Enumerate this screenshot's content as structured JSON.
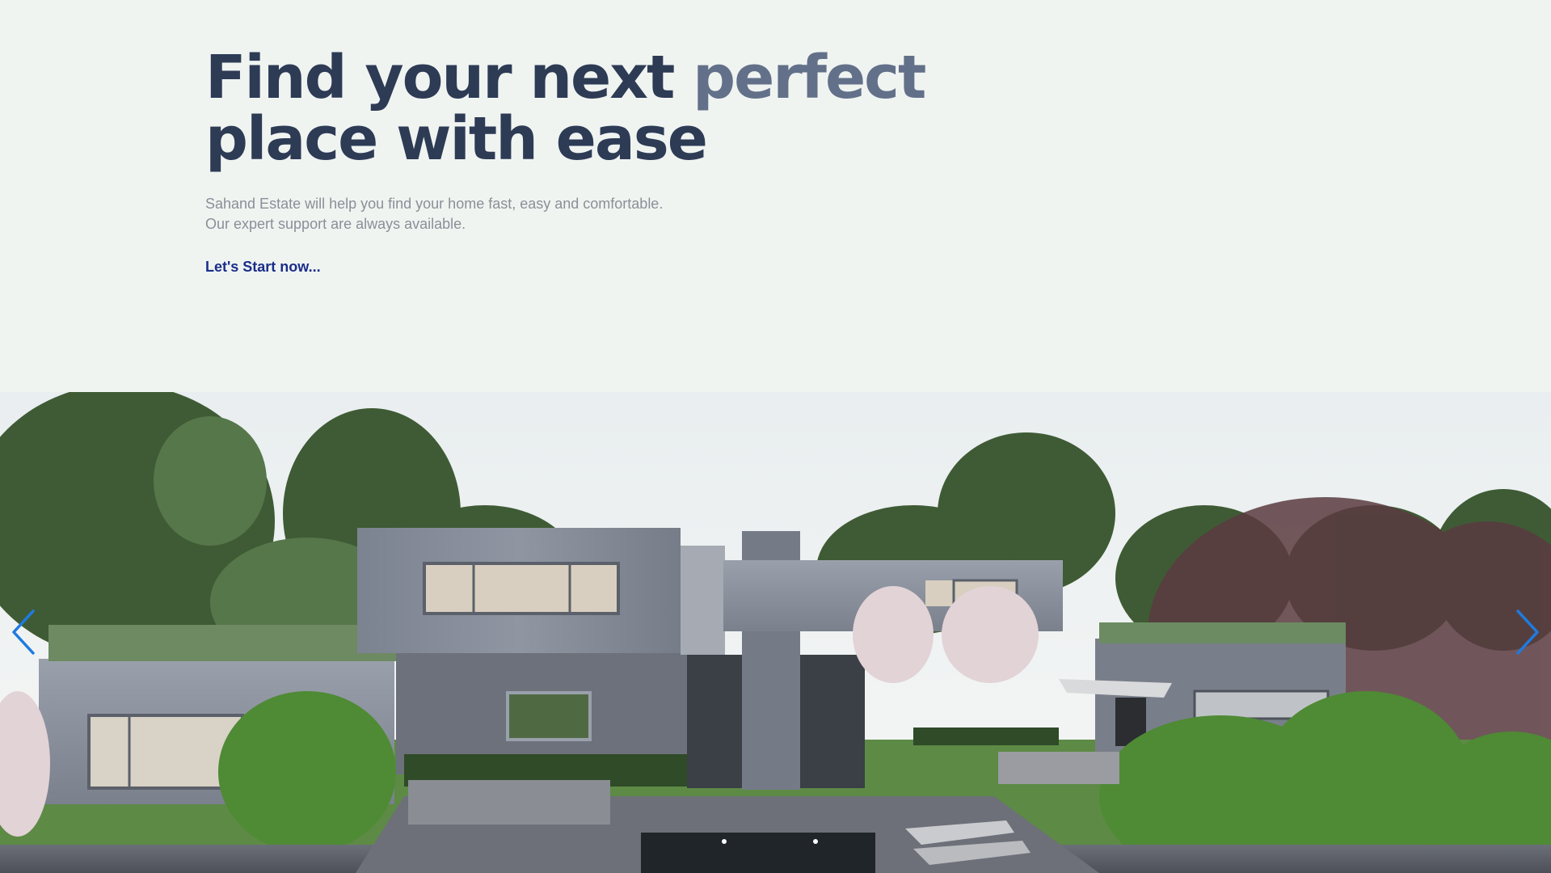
{
  "hero": {
    "headline_part1": "Find your next ",
    "headline_accent": "perfect",
    "headline_part2": "place with ease",
    "subtitle_line1": "Sahand Estate will help you find your home fast, easy and comfortable.",
    "subtitle_line2": "Our expert support are always available.",
    "cta_label": "Let's Start now..."
  },
  "slider": {
    "prev_icon": "chevron-left-icon",
    "next_icon": "chevron-right-icon",
    "image_description_icon": "house-photo",
    "arrow_color": "#1e7be0"
  },
  "colors": {
    "background": "#f0f4f1",
    "headline": "#2d3b55",
    "accent": "#637089",
    "subtitle": "#8a8f98",
    "cta": "#1a2e8a"
  }
}
